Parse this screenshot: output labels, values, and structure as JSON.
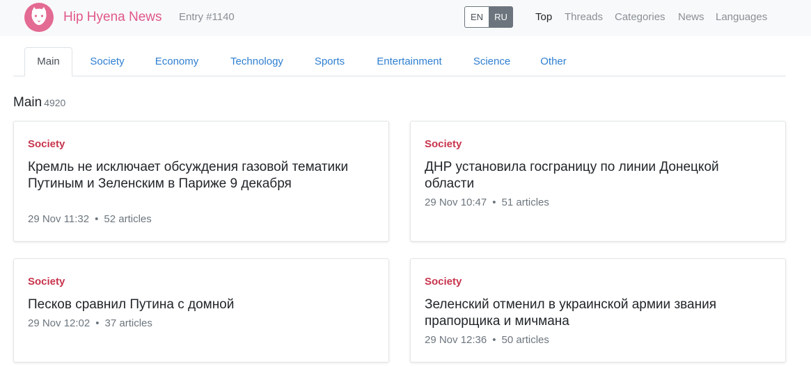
{
  "header": {
    "brand": "Hip Hyena News",
    "entry": "Entry #1140",
    "lang": {
      "en": "EN",
      "ru": "RU",
      "active": "RU"
    },
    "nav": [
      "Top",
      "Threads",
      "Categories",
      "News",
      "Languages"
    ],
    "nav_active": "Top"
  },
  "tabs": [
    "Main",
    "Society",
    "Economy",
    "Technology",
    "Sports",
    "Entertainment",
    "Science",
    "Other"
  ],
  "tabs_active": "Main",
  "section": {
    "title": "Main",
    "count": "4920"
  },
  "cards": [
    {
      "category": "Society",
      "title": "Кремль не исключает обсуждения газовой тематики Путиным и Зеленским в Париже 9 декабря",
      "time": "29 Nov 11:32",
      "articles": "52 articles"
    },
    {
      "category": "Society",
      "title": "ДНР установила госграницу по линии Донецкой области",
      "time": "29 Nov 10:47",
      "articles": "51 articles"
    },
    {
      "category": "Society",
      "title": "Песков сравнил Путина с домной",
      "time": "29 Nov 12:02",
      "articles": "37 articles"
    },
    {
      "category": "Society",
      "title": "Зеленский отменил в украинской армии звания прапорщика и мичмана",
      "time": "29 Nov 12:36",
      "articles": "50 articles"
    }
  ],
  "meta_separator": "•",
  "colors": {
    "brand": "#e0578a",
    "category": "#c8344c",
    "link": "#2e7fd1"
  },
  "icons": {
    "logo": "hyena-logo-icon"
  }
}
